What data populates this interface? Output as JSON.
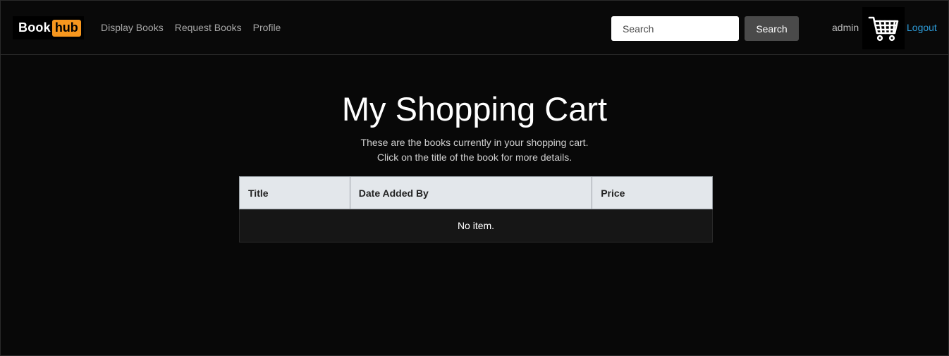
{
  "brand": {
    "part1": "Book",
    "part2": "hub",
    "accent_color": "#f7971e"
  },
  "nav": {
    "links": [
      {
        "label": "Display Books"
      },
      {
        "label": "Request Books"
      },
      {
        "label": "Profile"
      }
    ]
  },
  "search": {
    "placeholder": "Search",
    "button_label": "Search"
  },
  "user": {
    "name": "admin",
    "logout_label": "Logout"
  },
  "icons": {
    "cart": "shopping-cart-icon"
  },
  "main": {
    "title": "My Shopping Cart",
    "subtitle_line1": "These are the books currently in your shopping cart.",
    "subtitle_line2": "Click on the title of the book for more details."
  },
  "table": {
    "columns": [
      "Title",
      "Date Added By",
      "Price"
    ],
    "empty_message": "No item."
  }
}
